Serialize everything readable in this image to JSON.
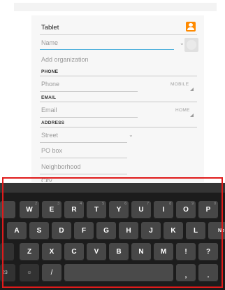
{
  "form": {
    "account_label": "Tablet",
    "name_placeholder": "Name",
    "add_org": "Add organization",
    "phone_section": "PHONE",
    "phone_placeholder": "Phone",
    "phone_type": "MOBILE",
    "email_section": "EMAIL",
    "email_placeholder": "Email",
    "email_type": "HOME",
    "address_section": "ADDRESS",
    "street_placeholder": "Street",
    "pobox_placeholder": "PO box",
    "neighborhood_placeholder": "Neighborhood",
    "city_placeholder": "City"
  },
  "keyboard": {
    "row1": [
      {
        "label": "W",
        "hint": "2"
      },
      {
        "label": "E",
        "hint": "3"
      },
      {
        "label": "R",
        "hint": "4"
      },
      {
        "label": "T",
        "hint": "5"
      },
      {
        "label": "Y",
        "hint": "6"
      },
      {
        "label": "U",
        "hint": "7"
      },
      {
        "label": "I",
        "hint": "8"
      },
      {
        "label": "O",
        "hint": "9"
      },
      {
        "label": "P",
        "hint": "0"
      }
    ],
    "row2": [
      "A",
      "S",
      "D",
      "F",
      "G",
      "H",
      "J",
      "K",
      "L",
      "Ne"
    ],
    "row3": [
      "Z",
      "X",
      "C",
      "V",
      "B",
      "N",
      "M",
      "!",
      "?"
    ],
    "row4_left": "23",
    "row4_emoji": "☺",
    "row4_slash": "/",
    "row4_comma": ",",
    "row4_period": "."
  },
  "colors": {
    "focus_line": "#36a5d8",
    "highlight_frame": "#e01b1b",
    "account_icon": "#ff8a00"
  }
}
